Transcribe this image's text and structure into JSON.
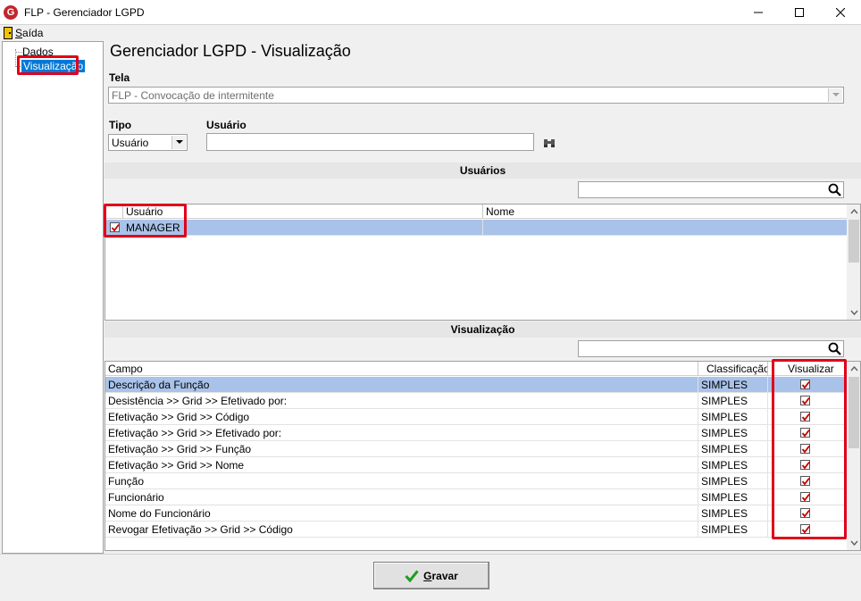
{
  "window": {
    "title": "FLP - Gerenciador LGPD",
    "icon_letter": "G"
  },
  "menu": {
    "exit_prefix": "S",
    "exit_rest": "aída"
  },
  "tree": {
    "items": [
      {
        "label": "Dados"
      },
      {
        "label": "Visualização",
        "selected": true
      }
    ]
  },
  "main": {
    "title": "Gerenciador LGPD - Visualização",
    "tela_label": "Tela",
    "tela_value": "FLP - Convocação de intermitente",
    "tipo_label": "Tipo",
    "tipo_value": "Usuário",
    "usuario_label": "Usuário",
    "usuario_value": ""
  },
  "users_section": {
    "header": "Usuários",
    "search_value": "",
    "columns": [
      "Usuário",
      "Nome"
    ],
    "rows": [
      {
        "checked": true,
        "usuario": "MANAGER",
        "nome": ""
      }
    ]
  },
  "view_section": {
    "header": "Visualização",
    "search_value": "",
    "columns": [
      "Campo",
      "Classificação",
      "Visualizar"
    ],
    "rows": [
      {
        "campo": "Descrição da Função",
        "classificacao": "SIMPLES",
        "visualizar": true
      },
      {
        "campo": "Desistência >> Grid >> Efetivado por:",
        "classificacao": "SIMPLES",
        "visualizar": true
      },
      {
        "campo": "Efetivação >> Grid >> Código",
        "classificacao": "SIMPLES",
        "visualizar": true
      },
      {
        "campo": "Efetivação >> Grid >> Efetivado por:",
        "classificacao": "SIMPLES",
        "visualizar": true
      },
      {
        "campo": "Efetivação >> Grid >> Função",
        "classificacao": "SIMPLES",
        "visualizar": true
      },
      {
        "campo": "Efetivação >> Grid >> Nome",
        "classificacao": "SIMPLES",
        "visualizar": true
      },
      {
        "campo": "Função",
        "classificacao": "SIMPLES",
        "visualizar": true
      },
      {
        "campo": "Funcionário",
        "classificacao": "SIMPLES",
        "visualizar": true
      },
      {
        "campo": "Nome do Funcionário",
        "classificacao": "SIMPLES",
        "visualizar": true
      },
      {
        "campo": "Revogar Efetivação >> Grid >> Código",
        "classificacao": "SIMPLES",
        "visualizar": true
      }
    ]
  },
  "footer": {
    "save_mnemonic": "G",
    "save_rest": "ravar"
  },
  "colors": {
    "selection": "#a9c2e9",
    "highlight_box": "#e0001a",
    "check": "#c00000",
    "save_check": "#1e9e1e"
  }
}
